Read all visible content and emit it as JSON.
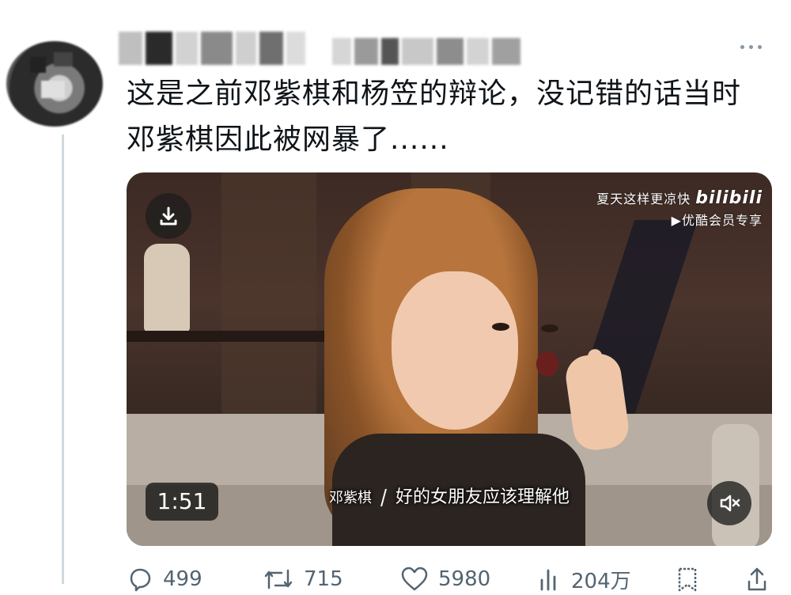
{
  "tweet": {
    "text": "这是之前邓紫棋和杨笠的辩论，没记错的话当时\n邓紫棋因此被网暴了......"
  },
  "media": {
    "watermark_line1": "夏天这样更凉快",
    "watermark_logo": "bilibili",
    "watermark_line2": "优酷会员专享",
    "subtitle_speaker": "邓紫棋",
    "subtitle_text": "好的女朋友应该理解他",
    "timer": "1:51",
    "icons": {
      "download": "download-icon",
      "mute": "volume-muted-icon"
    }
  },
  "actions": {
    "reply_count": "499",
    "retweet_count": "715",
    "like_count": "5980",
    "view_count": "204万"
  },
  "colors": {
    "text": "#0f1419",
    "secondary": "#536471",
    "thread_line": "#cfd9de"
  }
}
